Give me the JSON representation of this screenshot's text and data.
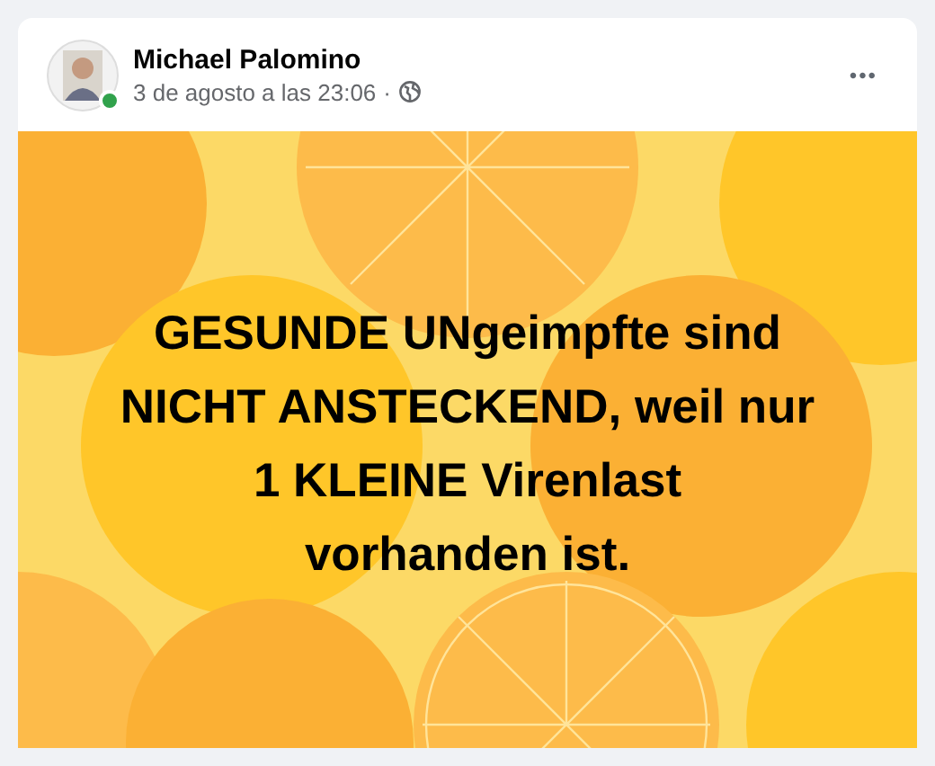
{
  "post": {
    "author": "Michael Palomino",
    "online": true,
    "timestamp": "3 de agosto a las 23:06",
    "audience_separator": "·",
    "menu": "•••",
    "text_lines": [
      "GESUNDE UNgeimpfte sind",
      "NICHT ANSTECKEND, weil nur",
      "1 KLEINE Virenlast",
      "vorhanden ist."
    ]
  }
}
